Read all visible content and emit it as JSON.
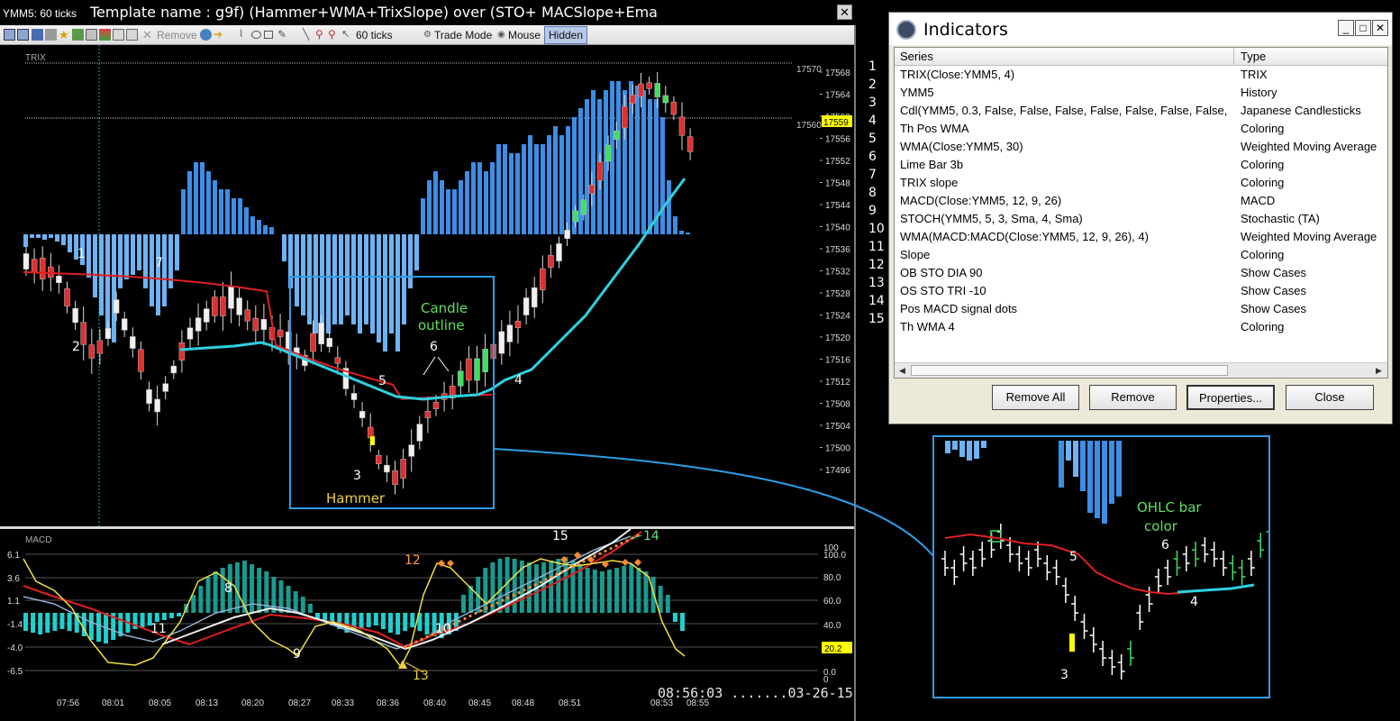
{
  "window": {
    "short_title": "YMM5: 60 ticks",
    "template_title": "Template name :  g9f) (Hammer+WMA+TrixSlope) over (STO+ MACSlope+Ema",
    "close_glyph": "✕"
  },
  "toolbar": {
    "remove_label": "Remove",
    "ticks_label": "60 ticks",
    "trade_mode_label": "Trade Mode",
    "mouse_label": "Mouse",
    "hidden_label": "Hidden"
  },
  "price_panel": {
    "label": "TRIX",
    "price_ticks": [
      "17568",
      "17564",
      "17560",
      "17556",
      "17552",
      "17548",
      "17544",
      "17540",
      "17536",
      "17532",
      "17528",
      "17524",
      "17520",
      "17516",
      "17512",
      "17508",
      "17504",
      "17500",
      "17496"
    ],
    "line_label_top": "17570",
    "line_label_mid": "17560",
    "last_price": "17559"
  },
  "macd_panel": {
    "label": "MACD",
    "left_ticks": [
      "6.1",
      "3.6",
      "1.1",
      "-1.4",
      "-4.0",
      "-6.5"
    ],
    "right_ticks": [
      "100",
      "100.0",
      "80.0",
      "60.0",
      "40.0",
      "20.0",
      "0.0",
      "0"
    ],
    "sto_value": "20.2",
    "time_ticks": [
      "07:56",
      "08:01",
      "08:05",
      "08:13",
      "08:20",
      "08:27",
      "08:33",
      "08:36",
      "08:40",
      "08:45",
      "08:48",
      "08:51",
      "08:53",
      "08:55"
    ],
    "timestamp": "08:56:03 .......03-26-15"
  },
  "annotations": {
    "n1": "1",
    "n2": "2",
    "n3": "3",
    "n4": "4",
    "n5": "5",
    "n6": "6",
    "n7": "7",
    "n8": "8",
    "n9": "9",
    "n10": "10",
    "n11": "11",
    "n12": "12",
    "n13": "13",
    "n14": "14",
    "n15": "15",
    "hammer": "Hammer",
    "candle_outline_1": "Candle",
    "candle_outline_2": "outline",
    "ohlc_1": "OHLC bar",
    "ohlc_2": "color"
  },
  "dialog": {
    "title": "Indicators",
    "col_series": "Series",
    "col_type": "Type",
    "rows": [
      {
        "num": "1",
        "series": "TRIX(Close:YMM5, 4)",
        "type": "TRIX"
      },
      {
        "num": "2",
        "series": "YMM5",
        "type": "History"
      },
      {
        "num": "3",
        "series": "Cdl(YMM5, 0.3, False, False, False, False, False, False, False,",
        "type": "Japanese Candlesticks"
      },
      {
        "num": "4",
        "series": "Th Pos WMA",
        "type": "Coloring"
      },
      {
        "num": "5",
        "series": "WMA(Close:YMM5, 30)",
        "type": "Weighted Moving Average"
      },
      {
        "num": "6",
        "series": "Lime Bar 3b",
        "type": "Coloring"
      },
      {
        "num": "7",
        "series": "TRIX slope",
        "type": "Coloring"
      },
      {
        "num": "8",
        "series": "MACD(Close:YMM5, 12, 9, 26)",
        "type": "MACD"
      },
      {
        "num": "9",
        "series": "STOCH(YMM5, 5, 3, Sma, 4, Sma)",
        "type": "Stochastic (TA)"
      },
      {
        "num": "10",
        "series": "WMA(MACD:MACD(Close:YMM5, 12, 9, 26), 4)",
        "type": "Weighted Moving Average"
      },
      {
        "num": "11",
        "series": "Slope",
        "type": "Coloring"
      },
      {
        "num": "12",
        "series": "OB STO DIA 90",
        "type": "Show Cases"
      },
      {
        "num": "13",
        "series": "OS STO TRI -10",
        "type": "Show Cases"
      },
      {
        "num": "14",
        "series": "Pos MACD signal dots",
        "type": "Show Cases"
      },
      {
        "num": "15",
        "series": "Th WMA 4",
        "type": "Coloring"
      }
    ],
    "btn_remove_all": "Remove All",
    "btn_remove": "Remove",
    "btn_properties": "Properties...",
    "btn_close": "Close",
    "min_glyph": "_",
    "max_glyph": "□",
    "close_glyph": "✕"
  },
  "colors": {
    "trix_bar": "#3d8ee6",
    "trix_bar_light": "#6eb3f5",
    "wma_red": "#e02020",
    "wma_cyan": "#30d0e0",
    "macd_hist": "#1a9a90",
    "macd_hist_neg": "#20d0d0",
    "sto_yellow": "#f0e040",
    "candle_up": "#f0f0f0",
    "candle_down": "#e03030",
    "candle_green": "#40e060",
    "price_box": "#ffff00",
    "inset_border": "#2d9de6"
  }
}
